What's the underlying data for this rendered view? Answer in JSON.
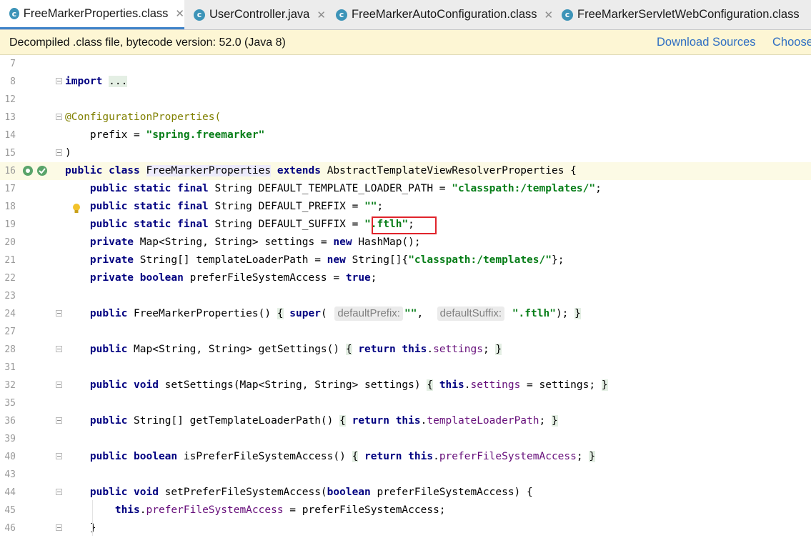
{
  "tabs": [
    {
      "label": "FreeMarkerProperties.class",
      "active": true,
      "icon": "class-icon"
    },
    {
      "label": "UserController.java",
      "active": false,
      "icon": "class-icon"
    },
    {
      "label": "FreeMarkerAutoConfiguration.class",
      "active": false,
      "icon": "class-icon"
    },
    {
      "label": "FreeMarkerServletWebConfiguration.class",
      "active": false,
      "icon": "class-icon"
    }
  ],
  "notice": {
    "message": "Decompiled .class file, bytecode version: 52.0 (Java 8)",
    "download_sources": "Download Sources",
    "choose_sources": "Choose"
  },
  "editor": {
    "line_numbers": [
      "7",
      "8",
      "12",
      "13",
      "14",
      "15",
      "16",
      "17",
      "18",
      "19",
      "20",
      "21",
      "22",
      "23",
      "24",
      "27",
      "28",
      "31",
      "32",
      "35",
      "36",
      "39",
      "40",
      "43",
      "44",
      "45",
      "46"
    ],
    "imports": "...",
    "annotation": "@ConfigurationProperties(",
    "prefix_key": "prefix = ",
    "prefix_value": "\"spring.freemarker\"",
    "class_name": "FreeMarkerProperties",
    "parent_class": "AbstractTemplateViewResolverProperties",
    "fields": {
      "loader_path_name": "DEFAULT_TEMPLATE_LOADER_PATH",
      "loader_path_value": "\"classpath:/templates/\"",
      "prefix_name": "DEFAULT_PREFIX",
      "prefix_value": "\"\"",
      "suffix_name": "DEFAULT_SUFFIX",
      "suffix_value": "\".ftlh\"",
      "settings_decl": "Map<String, String> settings = ",
      "settings_init": "HashMap();",
      "loader_array_decl": "String[] templateLoaderPath = ",
      "loader_array_type": "String[]{",
      "loader_array_value": "\"classpath:/templates/\"",
      "loader_array_end": "};",
      "prefer_decl": "preferFileSystemAccess = "
    },
    "hints": {
      "default_prefix": "defaultPrefix:",
      "default_suffix": "defaultSuffix:"
    },
    "ctor_suffix_value": "\".ftlh\""
  }
}
